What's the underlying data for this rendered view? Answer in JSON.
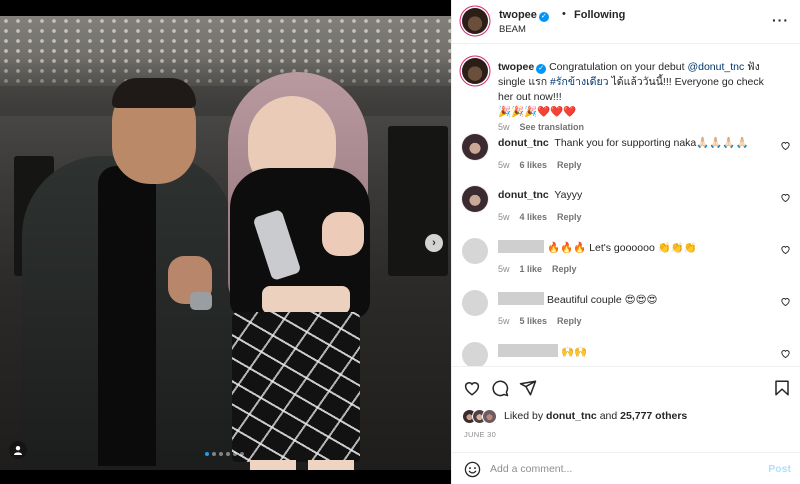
{
  "header": {
    "username": "twopee",
    "separator": "•",
    "follow_status": "Following",
    "location": "BEAM",
    "more_icon": "more-horizontal-icon"
  },
  "caption": {
    "username": "twopee",
    "text_before": "Congratulation on your debut ",
    "mention": "@donut_tnc",
    "text_middle": " ฟัง single แรก ",
    "hashtag": "#รักข้างเดียว",
    "text_after": " ได้แล้ววันนี้!!! Everyone go check her out now!!!",
    "emoji_line": "🎉🎉🎉❤️❤️❤️",
    "time": "5w",
    "see_translation": "See translation"
  },
  "comments": [
    {
      "username": "donut_tnc",
      "text": "Thank you for supporting naka🙏🏻🙏🏻🙏🏻🙏🏻",
      "time": "5w",
      "likes": "6 likes",
      "reply": "Reply"
    },
    {
      "username": "donut_tnc",
      "text": "Yayyy",
      "time": "5w",
      "likes": "4 likes",
      "reply": "Reply"
    },
    {
      "username": "",
      "text": "🔥🔥🔥 Let's goooooo 👏👏👏",
      "time": "5w",
      "likes": "1 like",
      "reply": "Reply"
    },
    {
      "username": "",
      "text": "Beautiful couple 😍😍😍",
      "time": "5w",
      "likes": "5 likes",
      "reply": "Reply"
    },
    {
      "username": "",
      "text": "🙌🙌",
      "time": "",
      "likes": "",
      "reply": ""
    }
  ],
  "likes": {
    "prefix": "Liked by ",
    "user": "donut_tnc",
    "middle": " and ",
    "others": "25,777 others"
  },
  "date": "JUNE 30",
  "add_comment": {
    "placeholder": "Add a comment...",
    "post_label": "Post"
  },
  "carousel": {
    "total": 6,
    "active": 0
  },
  "colors": {
    "accent": "#0095f6",
    "post_disabled": "#b2dffc",
    "heart": "#ed4956"
  }
}
